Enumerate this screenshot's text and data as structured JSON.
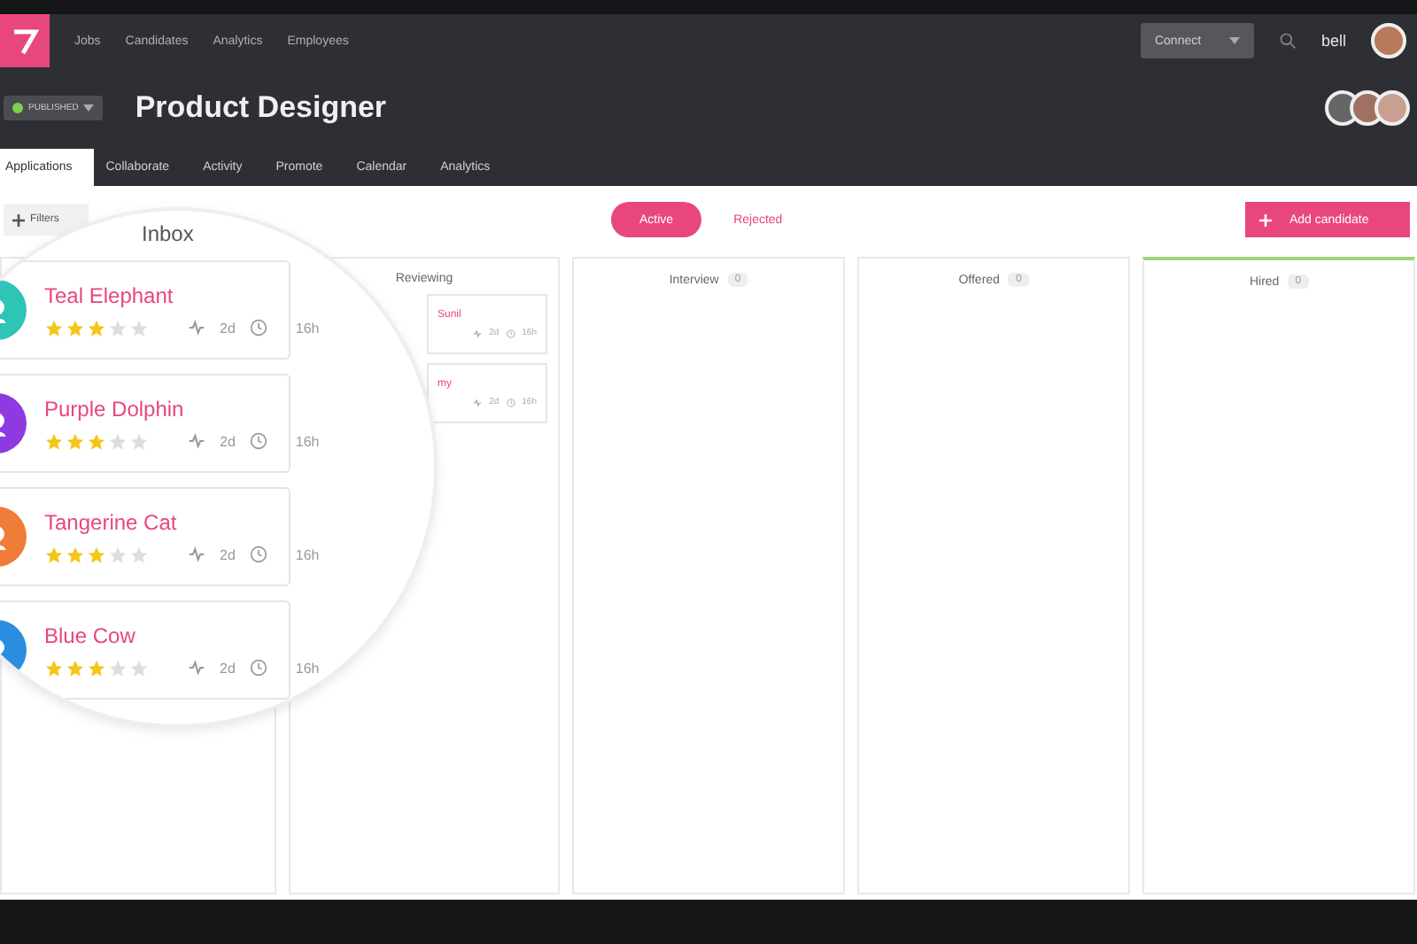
{
  "nav": {
    "items": [
      "Jobs",
      "Candidates",
      "Analytics",
      "Employees"
    ],
    "connect": "Connect",
    "user": "bell"
  },
  "header": {
    "status": "PUBLISHED",
    "title": "Product Designer"
  },
  "tabs": [
    {
      "label": "Applications",
      "selected": true
    },
    {
      "label": "Collaborate",
      "selected": false
    },
    {
      "label": "Activity",
      "selected": false
    },
    {
      "label": "Promote",
      "selected": false
    },
    {
      "label": "Calendar",
      "selected": false
    },
    {
      "label": "Analytics",
      "selected": false
    }
  ],
  "toolbar": {
    "filters": "Filters",
    "views": [
      {
        "label": "Active",
        "selected": true
      },
      {
        "label": "Rejected",
        "selected": false
      }
    ],
    "add": "Add candidate"
  },
  "inbox": {
    "title": "Inbox",
    "candidates": [
      {
        "name": "Teal Elephant",
        "color": "#2ec4b6",
        "stars": 3,
        "age": "2d",
        "time": "16h"
      },
      {
        "name": "Purple Dolphin",
        "color": "#8e3ae0",
        "stars": 3,
        "age": "2d",
        "time": "16h"
      },
      {
        "name": "Tangerine Cat",
        "color": "#f07c3a",
        "stars": 3,
        "age": "2d",
        "time": "16h"
      },
      {
        "name": "Blue Cow",
        "color": "#2a8ee0",
        "stars": 3,
        "age": "2d",
        "time": "16h"
      }
    ]
  },
  "columns": [
    {
      "title": "Reviewing",
      "highlight": false,
      "cards": [
        {
          "name": "Sunil",
          "age": "2d",
          "time": "16h"
        },
        {
          "name": "my",
          "age": "2d",
          "time": "16h"
        }
      ]
    },
    {
      "title": "Interview",
      "count": "0",
      "highlight": false
    },
    {
      "title": "Offered",
      "count": "0",
      "highlight": false
    },
    {
      "title": "Hired",
      "count": "0",
      "highlight": true
    }
  ]
}
